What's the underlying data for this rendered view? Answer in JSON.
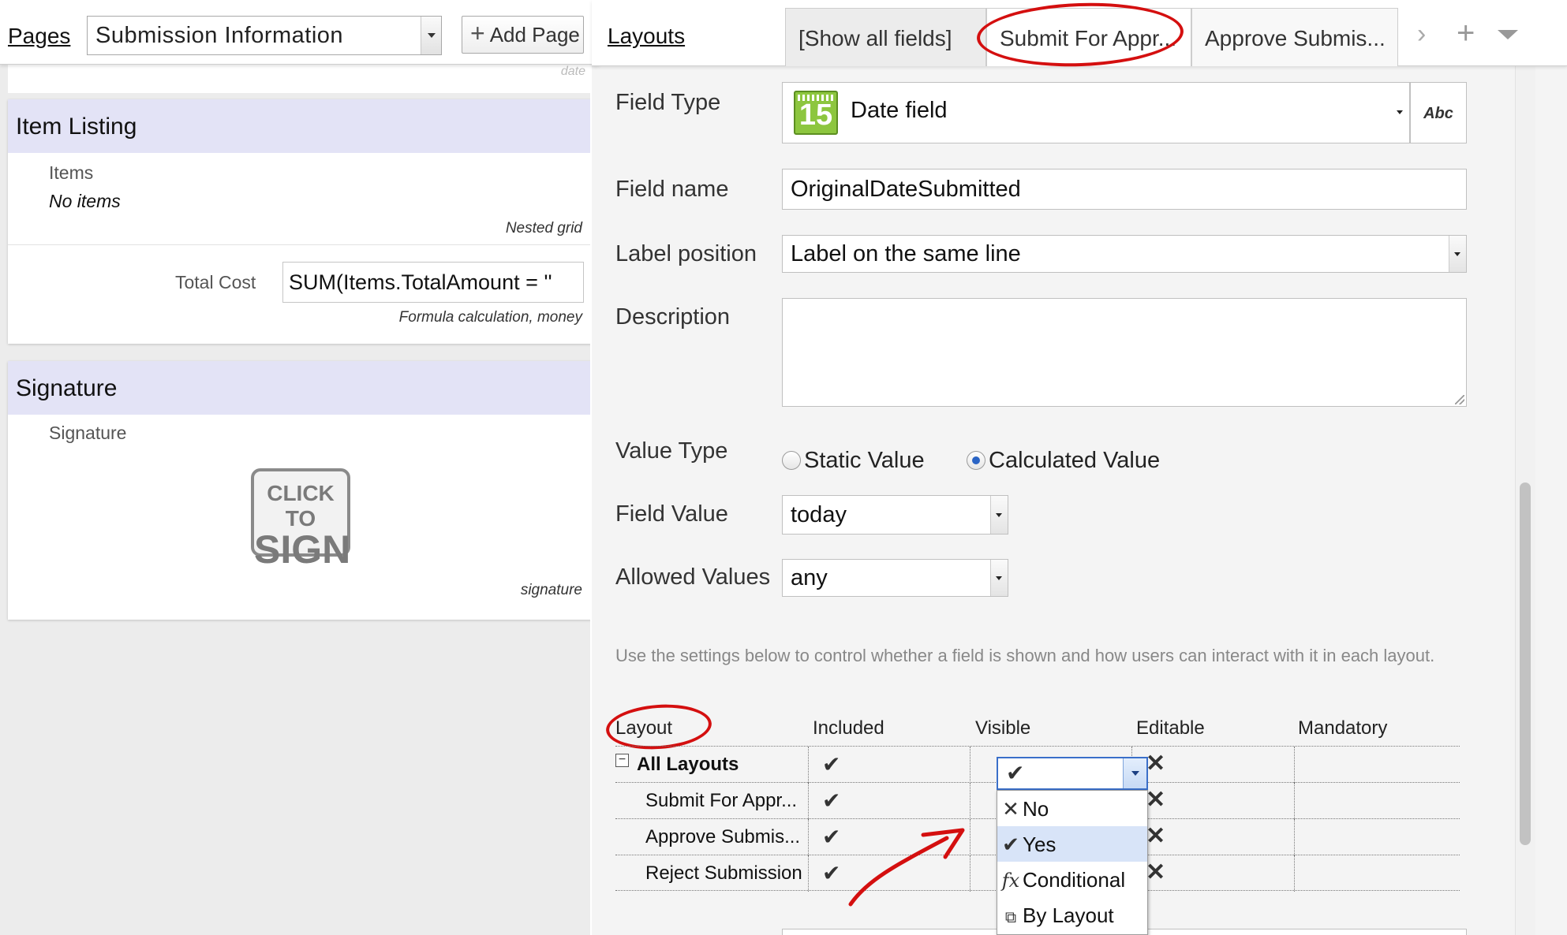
{
  "left": {
    "pages_label": "Pages",
    "page_select_value": "Submission Information",
    "add_page_label": "Add Page",
    "stub_hint": "date",
    "item_listing": {
      "title": "Item Listing",
      "items_label": "Items",
      "items_value": "No items",
      "items_hint": "Nested grid",
      "total_label": "Total Cost",
      "total_value": "SUM(Items.TotalAmount = ''",
      "total_hint": "Formula calculation, money"
    },
    "signature": {
      "title": "Signature",
      "label": "Signature",
      "button_line1": "CLICK TO",
      "button_line2": "SIGN",
      "hint": "signature"
    }
  },
  "right": {
    "layouts_label": "Layouts",
    "tabs": [
      {
        "label": "[Show all fields]"
      },
      {
        "label": "Submit For Appr..."
      },
      {
        "label": "Approve Submis..."
      }
    ],
    "form": {
      "field_type_label": "Field Type",
      "field_type_value": "Date field",
      "calendar_day": "15",
      "abc_label": "Abc",
      "field_name_label": "Field name",
      "field_name_value": "OriginalDateSubmitted",
      "label_position_label": "Label position",
      "label_position_value": "Label on the same line",
      "description_label": "Description",
      "description_value": "",
      "value_type_label": "Value Type",
      "value_type_options": [
        "Static Value",
        "Calculated Value"
      ],
      "value_type_selected": "Calculated Value",
      "field_value_label": "Field Value",
      "field_value_value": "today",
      "allowed_values_label": "Allowed Values",
      "allowed_values_value": "any"
    },
    "help_text": "Use the settings below to control whether a field is shown and how users can interact with it in each layout.",
    "grid": {
      "headers": [
        "Layout",
        "Included",
        "Visible",
        "Editable",
        "Mandatory"
      ],
      "rows": [
        {
          "name": "All Layouts"
        },
        {
          "name": "Submit For Appr..."
        },
        {
          "name": "Approve Submis..."
        },
        {
          "name": "Reject Submission"
        }
      ],
      "visible_menu": [
        "No",
        "Yes",
        "Conditional",
        "By Layout"
      ],
      "visible_menu_highlighted": "Yes"
    }
  },
  "colors": {
    "header_band": "#e3e3f6",
    "annotation_red": "#d40f0f",
    "calendar_green": "#8dc63f",
    "menu_highlight": "#d8e4f8"
  }
}
